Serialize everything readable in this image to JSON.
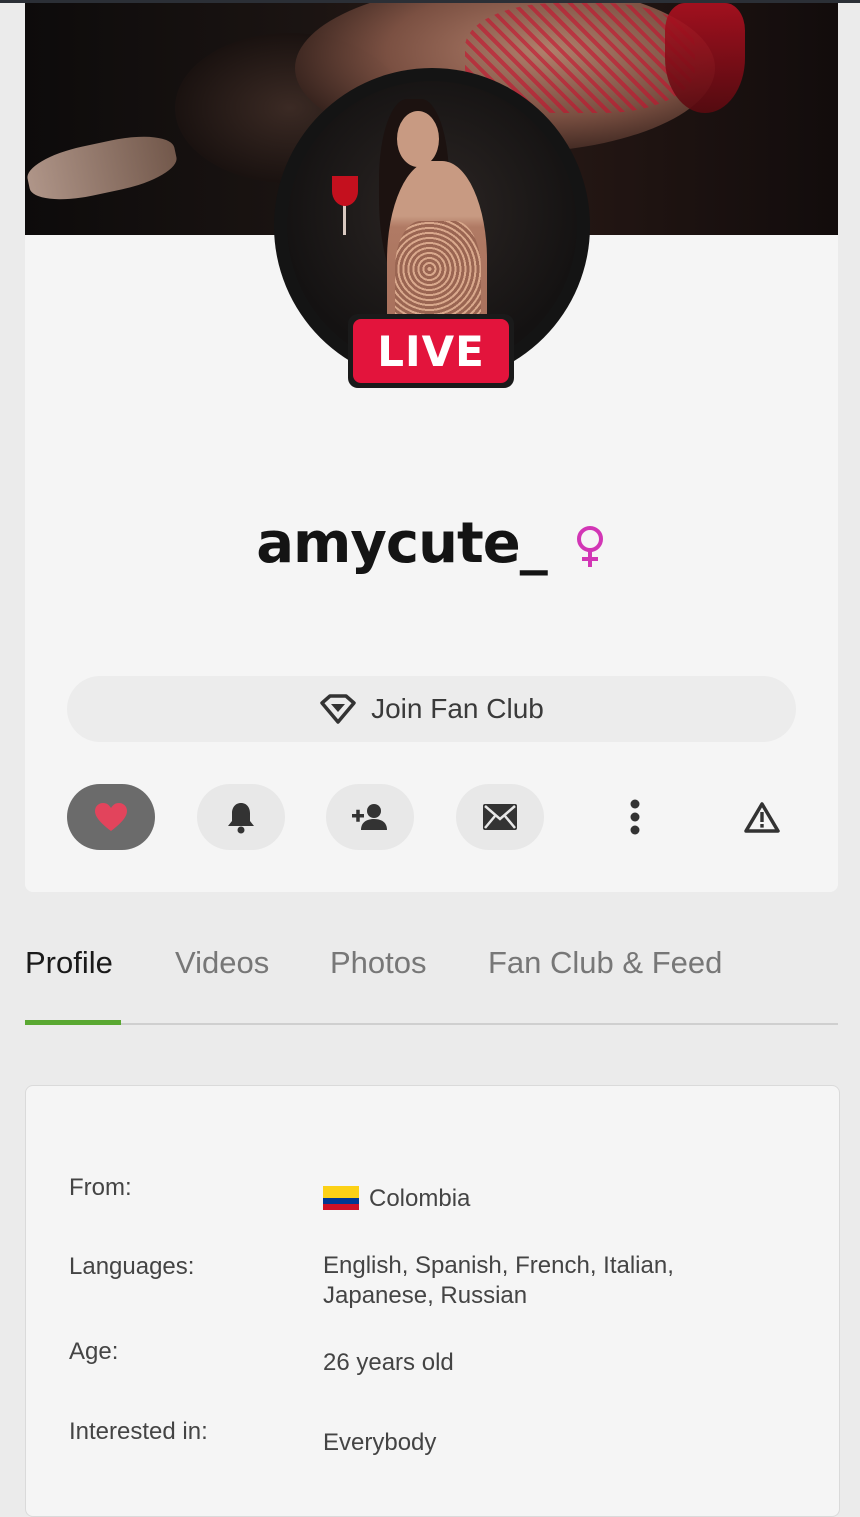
{
  "profile": {
    "username": "amycute_",
    "live_label": "LIVE",
    "gender_icon": "female-symbol-icon",
    "gender_color": "#d236b5"
  },
  "fanclub": {
    "label": "Join Fan Club",
    "icon": "diamond-icon"
  },
  "actions": [
    {
      "name": "favorite",
      "icon": "heart-icon",
      "color": "#e2445c"
    },
    {
      "name": "notify",
      "icon": "bell-icon"
    },
    {
      "name": "follow",
      "icon": "add-user-icon"
    },
    {
      "name": "message",
      "icon": "envelope-icon"
    },
    {
      "name": "more",
      "icon": "more-vertical-icon"
    },
    {
      "name": "report",
      "icon": "warning-icon"
    }
  ],
  "tabs": [
    {
      "label": "Profile",
      "active": true
    },
    {
      "label": "Videos",
      "active": false
    },
    {
      "label": "Photos",
      "active": false
    },
    {
      "label": "Fan Club & Feed",
      "active": false
    }
  ],
  "tab_accent": "#5aa832",
  "info": {
    "from_label": "From:",
    "from_value": "Colombia",
    "languages_label": "Languages:",
    "languages_value_line1": "English, Spanish, French, Italian,",
    "languages_value_line2": "Japanese, Russian",
    "age_label": "Age:",
    "age_value": "26 years old",
    "interested_label": "Interested in:",
    "interested_value": "Everybody"
  }
}
